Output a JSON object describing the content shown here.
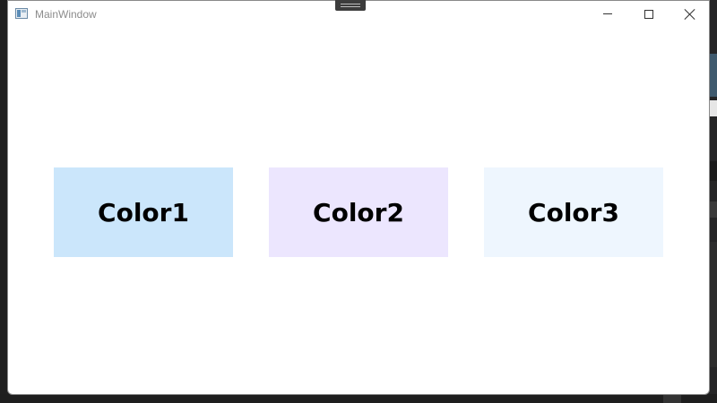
{
  "window": {
    "title": "MainWindow"
  },
  "boxes": [
    {
      "label": "Color1",
      "color": "#cbe6fb"
    },
    {
      "label": "Color2",
      "color": "#ece6fe"
    },
    {
      "label": "Color3",
      "color": "#eef6fe"
    }
  ],
  "icons": {
    "app": "window-app-icon",
    "minimize": "minimize-icon",
    "maximize": "maximize-icon",
    "close": "close-icon"
  }
}
